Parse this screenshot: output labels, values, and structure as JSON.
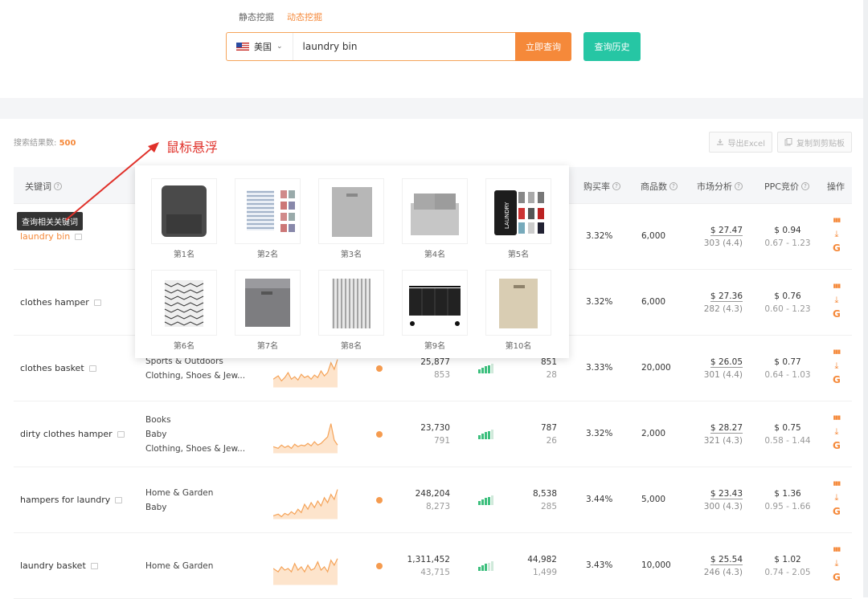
{
  "search": {
    "tabs": [
      "静态挖掘",
      "动态挖掘"
    ],
    "active_tab": 1,
    "country": "美国",
    "query": "laundry bin",
    "search_button": "立即查询",
    "history_button": "查询历史"
  },
  "results": {
    "label": "搜索结果数:",
    "count": "500",
    "export_excel": "导出Excel",
    "copy_clipboard": "复制到剪贴板"
  },
  "annotation": "鼠标悬浮",
  "tooltip": "查询相关关键词",
  "headers": {
    "keyword": "关键词",
    "buy_rate": "购买率",
    "products": "商品数",
    "market": "市场分析",
    "ppc": "PPC竞价",
    "ops": "操作"
  },
  "popup": {
    "items": [
      "第1名",
      "第2名",
      "第3名",
      "第4名",
      "第5名",
      "第6名",
      "第7名",
      "第8名",
      "第9名",
      "第10名"
    ],
    "product_image_text": "LAUNDRY"
  },
  "rows": [
    {
      "keyword": "laundry bin",
      "categories": [],
      "search_volume": "",
      "search_volume_sub": "",
      "clicks": "",
      "clicks_sub": "",
      "buy_rate": "3.32%",
      "products": "6,000",
      "market_price": "$ 27.47",
      "market_sub": "303 (4.4)",
      "ppc": "$ 0.94",
      "ppc_range": "0.67 - 1.23"
    },
    {
      "keyword": "clothes hamper",
      "categories": [],
      "search_volume": "",
      "search_volume_sub": "",
      "clicks": "",
      "clicks_sub": "",
      "buy_rate": "3.32%",
      "products": "6,000",
      "market_price": "$ 27.36",
      "market_sub": "282 (4.3)",
      "ppc": "$ 0.76",
      "ppc_range": "0.60 - 1.23"
    },
    {
      "keyword": "clothes basket",
      "categories": [
        "Sports & Outdoors",
        "Clothing, Shoes & Jew..."
      ],
      "search_volume": "25,877",
      "search_volume_sub": "853",
      "clicks": "851",
      "clicks_sub": "28",
      "buy_rate": "3.33%",
      "products": "20,000",
      "market_price": "$ 26.05",
      "market_sub": "301 (4.4)",
      "ppc": "$ 0.77",
      "ppc_range": "0.64 - 1.03"
    },
    {
      "keyword": "dirty clothes hamper",
      "categories": [
        "Books",
        "Baby",
        "Clothing, Shoes & Jew..."
      ],
      "search_volume": "23,730",
      "search_volume_sub": "791",
      "clicks": "787",
      "clicks_sub": "26",
      "buy_rate": "3.32%",
      "products": "2,000",
      "market_price": "$ 28.27",
      "market_sub": "321 (4.3)",
      "ppc": "$ 0.75",
      "ppc_range": "0.58 - 1.44"
    },
    {
      "keyword": "hampers for laundry",
      "categories": [
        "Home & Garden",
        "Baby"
      ],
      "search_volume": "248,204",
      "search_volume_sub": "8,273",
      "clicks": "8,538",
      "clicks_sub": "285",
      "buy_rate": "3.44%",
      "products": "5,000",
      "market_price": "$ 23.43",
      "market_sub": "300 (4.3)",
      "ppc": "$ 1.36",
      "ppc_range": "0.95 - 1.66"
    },
    {
      "keyword": "laundry basket",
      "categories": [
        "Home & Garden"
      ],
      "search_volume": "1,311,452",
      "search_volume_sub": "43,715",
      "clicks": "44,982",
      "clicks_sub": "1,499",
      "buy_rate": "3.43%",
      "products": "10,000",
      "market_price": "$ 25.54",
      "market_sub": "246 (4.3)",
      "ppc": "$ 1.02",
      "ppc_range": "0.74 - 2.05"
    }
  ],
  "colors": {
    "accent": "#f5893a",
    "teal": "#26c6a4",
    "green": "#3cbf7d",
    "annotation": "#e0312a"
  }
}
